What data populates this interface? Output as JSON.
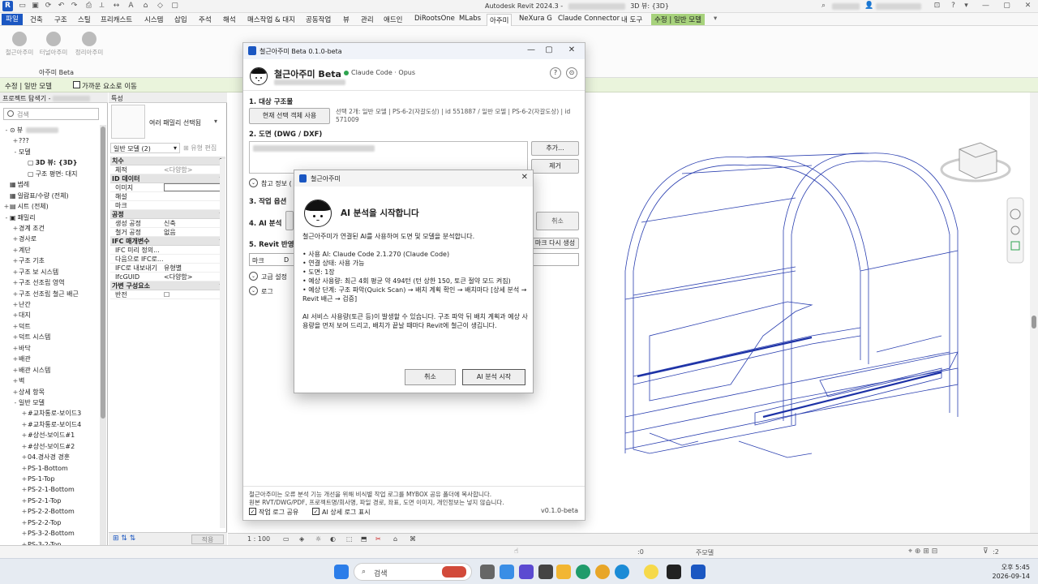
{
  "titlebar": {
    "title": "Autodesk Revit 2024.3 -",
    "title_suffix": "3D 뷰: {3D}",
    "logo": "R"
  },
  "menu": {
    "file": "파일",
    "tabs": [
      "건축",
      "구조",
      "스틸",
      "프리캐스트",
      "시스템",
      "삽입",
      "주석",
      "해석",
      "매스작업 & 대지",
      "공동작업",
      "뷰",
      "관리",
      "애드인",
      "DiRootsOne",
      "MLabs",
      "아주미",
      "NeXura G",
      "Claude Connector",
      "내 도구"
    ],
    "contextual": "수정 | 일반 모델"
  },
  "ribbon": {
    "buttons": [
      "철근아주미",
      "터널아주미",
      "정리아주미"
    ],
    "panel_label": "아주미 Beta"
  },
  "optionsbar": {
    "mode": "수정 | 일반 모델",
    "checkbox_label": "가까운 요소로 이동"
  },
  "project_browser": {
    "title": "프로젝트 탐색기 -",
    "search_placeholder": "검색",
    "items": [
      {
        "t": "-",
        "label": "뷰",
        "lvl": 0,
        "icon": "⊙"
      },
      {
        "t": "+",
        "label": "???",
        "lvl": 1
      },
      {
        "t": "-",
        "label": "모델",
        "lvl": 1
      },
      {
        "t": "",
        "label": "3D 뷰: {3D}",
        "lvl": 2,
        "bold": true,
        "icon": "▢"
      },
      {
        "t": "",
        "label": "구조 평면: 대지",
        "lvl": 2,
        "icon": "▢"
      },
      {
        "t": "",
        "label": "범례",
        "lvl": 0,
        "icon": "▦"
      },
      {
        "t": "",
        "label": "일람표/수량 (전체)",
        "lvl": 0,
        "icon": "▦"
      },
      {
        "t": "+",
        "label": "시트 (전체)",
        "lvl": 0,
        "icon": "▤"
      },
      {
        "t": "-",
        "label": "패밀리",
        "lvl": 0,
        "icon": "▣"
      },
      {
        "t": "+",
        "label": "경계 조건",
        "lvl": 1
      },
      {
        "t": "+",
        "label": "경사로",
        "lvl": 1
      },
      {
        "t": "+",
        "label": "계단",
        "lvl": 1
      },
      {
        "t": "+",
        "label": "구조 기초",
        "lvl": 1
      },
      {
        "t": "+",
        "label": "구조 보 시스템",
        "lvl": 1
      },
      {
        "t": "+",
        "label": "구조 선조립 영역",
        "lvl": 1
      },
      {
        "t": "+",
        "label": "구조 선조립 철근 배근",
        "lvl": 1
      },
      {
        "t": "+",
        "label": "난간",
        "lvl": 1
      },
      {
        "t": "+",
        "label": "대지",
        "lvl": 1
      },
      {
        "t": "+",
        "label": "덕트",
        "lvl": 1
      },
      {
        "t": "+",
        "label": "덕트 시스템",
        "lvl": 1
      },
      {
        "t": "+",
        "label": "바닥",
        "lvl": 1
      },
      {
        "t": "+",
        "label": "배관",
        "lvl": 1
      },
      {
        "t": "+",
        "label": "배관 시스템",
        "lvl": 1
      },
      {
        "t": "+",
        "label": "벽",
        "lvl": 1
      },
      {
        "t": "+",
        "label": "상세 항목",
        "lvl": 1
      },
      {
        "t": "-",
        "label": "일반 모델",
        "lvl": 1
      },
      {
        "t": "+",
        "label": "#교차통로-보이드3",
        "lvl": 2
      },
      {
        "t": "+",
        "label": "#교차통로-보이드4",
        "lvl": 2
      },
      {
        "t": "+",
        "label": "#상선-보이드#1",
        "lvl": 2
      },
      {
        "t": "+",
        "label": "#상선-보이드#2",
        "lvl": 2
      },
      {
        "t": "+",
        "label": "04.경사경 경훈",
        "lvl": 2
      },
      {
        "t": "+",
        "label": "PS-1-Bottom",
        "lvl": 2
      },
      {
        "t": "+",
        "label": "PS-1-Top",
        "lvl": 2
      },
      {
        "t": "+",
        "label": "PS-2-1-Bottom",
        "lvl": 2
      },
      {
        "t": "+",
        "label": "PS-2-1-Top",
        "lvl": 2
      },
      {
        "t": "+",
        "label": "PS-2-2-Bottom",
        "lvl": 2
      },
      {
        "t": "+",
        "label": "PS-2-2-Top",
        "lvl": 2
      },
      {
        "t": "+",
        "label": "PS-3-2-Bottom",
        "lvl": 2
      },
      {
        "t": "+",
        "label": "PS-3-2-Top",
        "lvl": 2
      }
    ]
  },
  "properties": {
    "title": "특성",
    "type_name": "여러 패밀리 선택됨",
    "selection": "일반 모델 (2)",
    "edit_type": "유형 편집",
    "apply": "적용",
    "sections": [
      {
        "name": "치수",
        "rows": [
          {
            "k": "체적",
            "v": "<다양함>",
            "dim": true
          }
        ]
      },
      {
        "name": "ID 데이터",
        "rows": [
          {
            "k": "이미지",
            "v": "",
            "box": true
          },
          {
            "k": "해설",
            "v": ""
          },
          {
            "k": "마크",
            "v": ""
          }
        ]
      },
      {
        "name": "공정",
        "rows": [
          {
            "k": "생성 공정",
            "v": "신축"
          },
          {
            "k": "철거 공정",
            "v": "없음"
          }
        ]
      },
      {
        "name": "IFC 매개변수",
        "rows": [
          {
            "k": "IFC 미리 정의...",
            "v": ""
          },
          {
            "k": "다음으로 IFC로...",
            "v": ""
          },
          {
            "k": "IFC로 내보내기",
            "v": "유형별"
          },
          {
            "k": "IfcGUID",
            "v": "<다양함>"
          }
        ]
      },
      {
        "name": "가변 구성요소",
        "rows": [
          {
            "k": "반전",
            "v": "☐"
          }
        ]
      }
    ]
  },
  "main_window": {
    "title": "철근아주미 Beta 0.1.0-beta",
    "app_name": "철근아주미 Beta",
    "status": "Claude Code · Opus",
    "help": "?",
    "info": "⊙",
    "s1": "1. 대상 구조물",
    "use_selection": "현재 선택 객체 사용",
    "selection_info": "선택 2개: 일반 모델 | PS-6-2(자갈도상) | id 551887 / 일반 모델 | PS-6-2(자갈도상) | id 571009",
    "s2": "2. 도면 (DWG / DXF)",
    "add": "추가...",
    "remove": "제거",
    "ref_info": "참고 정보 (",
    "s3": "3. 작업 옵션",
    "s4": "4. AI 분석",
    "cancel": "취소",
    "s5": "5. Revit 반영",
    "regen": "마크 다시 생성",
    "col_mark": "마크",
    "col_d": "D",
    "advanced": "고급 설정",
    "log": "로그",
    "footer1": "철근아주미는 오류 분석 기능 개선을 위해 비식별 작업 로그를 MYBOX 공유 폴더에 복사합니다.",
    "footer2": "원본 RVT/DWG/PDF, 프로젝트명/회사명, 파일 경로, 좌표, 도면 이미지, 개인정보는 넣지 않습니다.",
    "cb_share": "작업 로그 공유",
    "cb_ai": "AI 상세 로그 표시",
    "version": "v0.1.0-beta"
  },
  "dialog": {
    "title": "철근아주미",
    "heading": "AI 분석을 시작합니다",
    "intro": "철근아주미가 연결된 AI를 사용하여 도면 및 모델을 분석합니다.",
    "bullets": [
      "• 사용 AI: Claude Code 2.1.270 (Claude Code)",
      "• 연결 상태: 사용 가능",
      "• 도면: 1장",
      "• 예상 사용량: 최근 4회 평균 약 494턴 (턴 상한 150, 토큰 절약 모드 켜짐)",
      "• 예상 단계: 구조 파악(Quick Scan) → 배치 계획 확인 → 배치마다 [상세 분석 → Revit 배근 → 검증]"
    ],
    "note": "AI 서비스 사용량(토큰 등)이 발생할 수 있습니다. 구조 파악 뒤 배치 계획과 예상 사용량을 먼저 보여 드리고, 배치가 끝날 때마다 Revit에 철근이 생깁니다.",
    "cancel": "취소",
    "start": "AI 분석 시작"
  },
  "viewbar": {
    "scale": "1 : 100"
  },
  "statusbar": {
    "right_value": ":0",
    "model": "주모델",
    "filter": ":2"
  },
  "taskbar": {
    "search": "검색",
    "time": "오후 5:45",
    "date": "2026-09-14"
  },
  "colors": {
    "accent": "#1b57c2",
    "ribbon_ctx": "#a7d27c",
    "model_lines": "#2a3fb0",
    "status_ok": "#2ea44f"
  }
}
